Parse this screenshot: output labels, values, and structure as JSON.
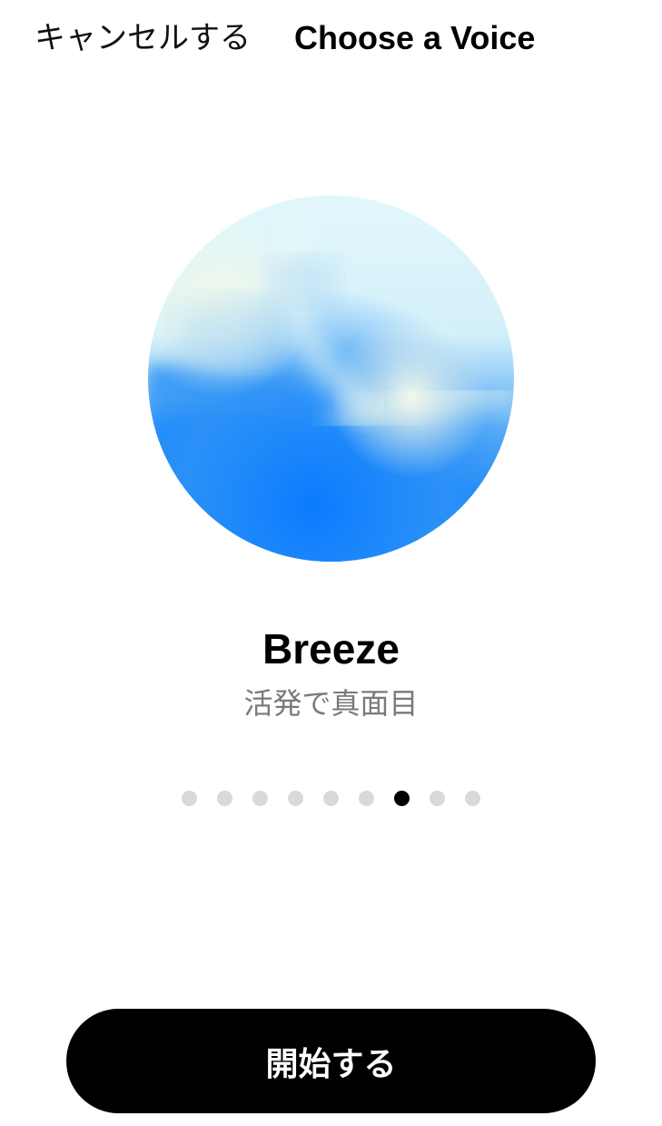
{
  "header": {
    "cancel_label": "キャンセルする",
    "title": "Choose a Voice"
  },
  "voice": {
    "name": "Breeze",
    "description": "活発で真面目"
  },
  "pagination": {
    "total": 9,
    "active_index": 6
  },
  "start_button": {
    "label": "開始する"
  },
  "colors": {
    "orb_light": "#def6fb",
    "orb_mid": "#4fa8f5",
    "orb_deep": "#0a7bff",
    "dot_inactive": "#d9d9d9",
    "dot_active": "#000000",
    "button_bg": "#000000"
  }
}
